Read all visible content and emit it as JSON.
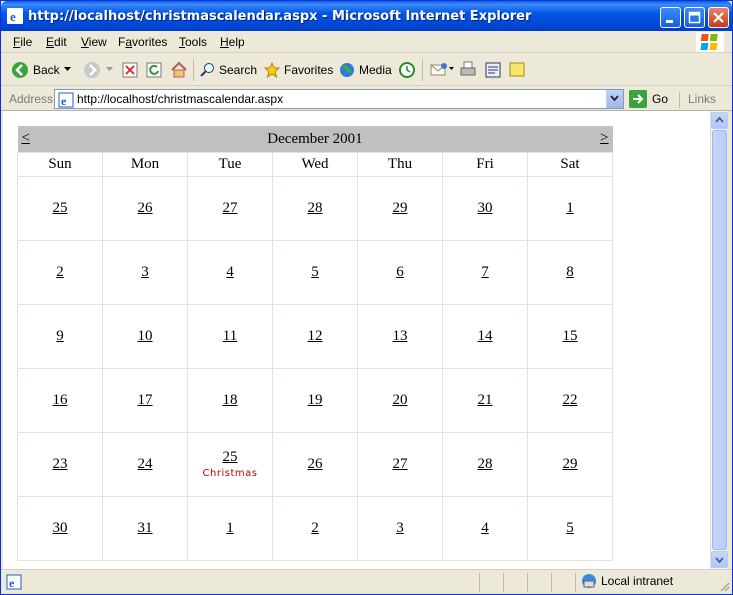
{
  "window": {
    "title": "http://localhost/christmascalendar.aspx - Microsoft Internet Explorer"
  },
  "menu": [
    {
      "accel": "F",
      "rest": "ile"
    },
    {
      "accel": "E",
      "rest": "dit"
    },
    {
      "accel": "V",
      "rest": "iew"
    },
    {
      "accel": "",
      "rest": "Favorites",
      "underline_index": 1
    },
    {
      "accel": "T",
      "rest": "ools"
    },
    {
      "accel": "H",
      "rest": "elp"
    }
  ],
  "toolbar": {
    "back_label": "Back",
    "search_label": "Search",
    "favorites_label": "Favorites",
    "media_label": "Media"
  },
  "address": {
    "label": "Address",
    "url": "http://localhost/christmascalendar.aspx",
    "go_label": "Go",
    "links_label": "Links"
  },
  "calendar": {
    "title": "December 2001",
    "prev": "<",
    "next": ">",
    "weekdays": [
      "Sun",
      "Mon",
      "Tue",
      "Wed",
      "Thu",
      "Fri",
      "Sat"
    ],
    "weeks": [
      [
        "25",
        "26",
        "27",
        "28",
        "29",
        "30",
        "1"
      ],
      [
        "2",
        "3",
        "4",
        "5",
        "6",
        "7",
        "8"
      ],
      [
        "9",
        "10",
        "11",
        "12",
        "13",
        "14",
        "15"
      ],
      [
        "16",
        "17",
        "18",
        "19",
        "20",
        "21",
        "22"
      ],
      [
        "23",
        "24",
        "25",
        "26",
        "27",
        "28",
        "29"
      ],
      [
        "30",
        "31",
        "1",
        "2",
        "3",
        "4",
        "5"
      ]
    ],
    "note": {
      "week": 4,
      "day": 2,
      "text": "Christmas",
      "color": "#c00000"
    }
  },
  "status": {
    "zone_label": "Local intranet"
  },
  "colors": {
    "titlebar": "#0058e6",
    "calendar_header": "#c0c0c0",
    "holiday_text": "#c00000"
  }
}
